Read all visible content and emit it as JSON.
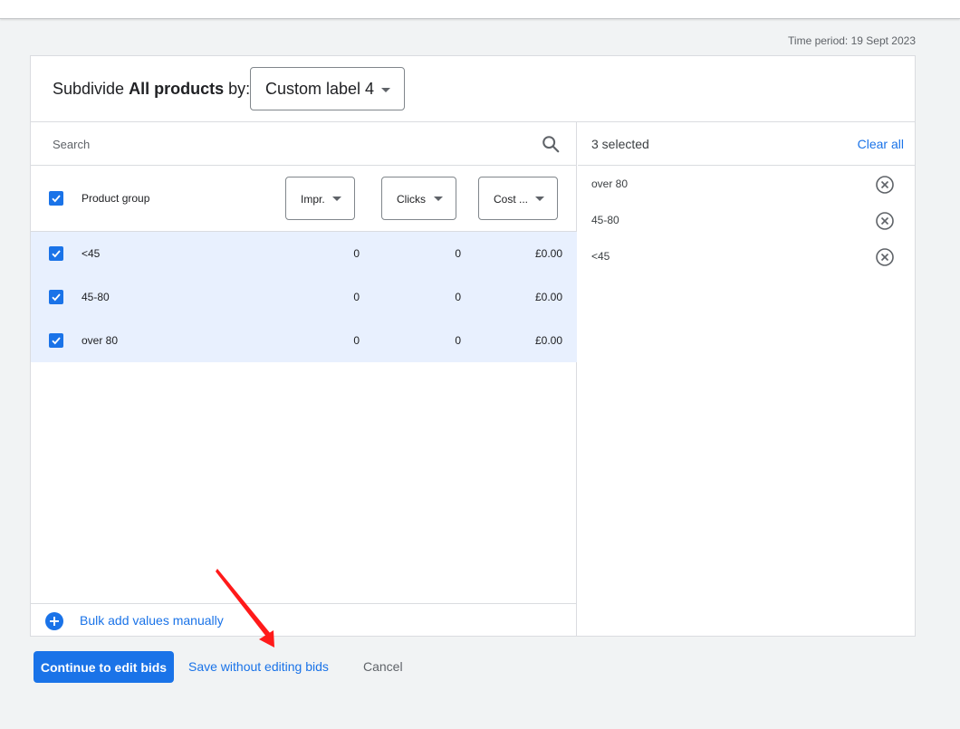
{
  "header": {
    "time_period": "Time period: 19 Sept 2023"
  },
  "subdivide": {
    "prefix": "Subdivide",
    "bold": "All products",
    "suffix": "by:",
    "dimension": "Custom label 4"
  },
  "search": {
    "placeholder": "Search"
  },
  "table": {
    "column_label": "Product group",
    "metrics": [
      "Impr.",
      "Clicks",
      "Cost ..."
    ],
    "rows": [
      {
        "name": "<45",
        "impr": "0",
        "clicks": "0",
        "cost": "£0.00"
      },
      {
        "name": "45-80",
        "impr": "0",
        "clicks": "0",
        "cost": "£0.00"
      },
      {
        "name": "over 80",
        "impr": "0",
        "clicks": "0",
        "cost": "£0.00"
      }
    ],
    "bulk_add_label": "Bulk add values manually"
  },
  "selected": {
    "count_label": "3 selected",
    "clear_label": "Clear all",
    "items": [
      "over 80",
      "45-80",
      "<45"
    ]
  },
  "footer": {
    "continue_label": "Continue to edit bids",
    "save_label": "Save without editing bids",
    "cancel_label": "Cancel"
  },
  "colors": {
    "accent": "#1a73e8",
    "selected_row_bg": "#e8f0fe",
    "annotation_arrow": "#ff1a1a"
  },
  "icons": {
    "search": "search-icon",
    "checkbox": "checkbox-checked-icon",
    "remove": "remove-circle-icon",
    "add": "add-circle-icon",
    "dropdown": "caret-down-icon"
  }
}
